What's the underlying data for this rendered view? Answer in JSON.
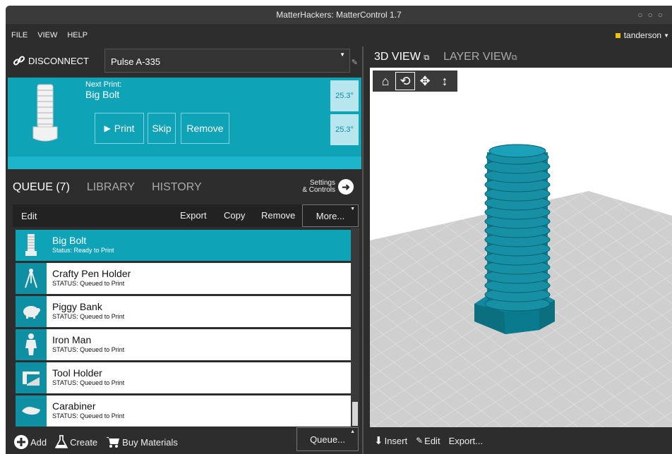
{
  "window": {
    "title": "MatterHackers: MatterControl 1.7"
  },
  "menu": {
    "items": [
      "FILE",
      "VIEW",
      "HELP"
    ],
    "user": "tanderson"
  },
  "connection": {
    "disconnect_label": "DISCONNECT",
    "printer": "Pulse A-335"
  },
  "next_print": {
    "label": "Next Print:",
    "name": "Big Bolt",
    "print_label": "Print",
    "skip_label": "Skip",
    "remove_label": "Remove",
    "temp1": "25.3°",
    "temp2": "25.3°"
  },
  "tabs": {
    "queue": "QUEUE (7)",
    "library": "LIBRARY",
    "history": "HISTORY",
    "settings_line1": "Settings",
    "settings_line2": "& Controls"
  },
  "toolbar": {
    "edit": "Edit",
    "export": "Export",
    "copy": "Copy",
    "remove": "Remove",
    "more": "More..."
  },
  "queue_items": [
    {
      "name": "Big Bolt",
      "status": "Status: Ready to Print",
      "icon": "bolt-icon"
    },
    {
      "name": "Crafty Pen Holder",
      "status": "STATUS: Queued to Print",
      "icon": "pen-holder-icon"
    },
    {
      "name": "Piggy Bank",
      "status": "STATUS: Queued to Print",
      "icon": "piggy-bank-icon"
    },
    {
      "name": "Iron Man",
      "status": "STATUS: Queued to Print",
      "icon": "figure-icon"
    },
    {
      "name": "Tool Holder",
      "status": "STATUS: Queued to Print",
      "icon": "tool-holder-icon"
    },
    {
      "name": "Carabiner",
      "status": "STATUS: Queued to Print",
      "icon": "carabiner-icon"
    }
  ],
  "bottom": {
    "add": "Add",
    "create": "Create",
    "buy": "Buy Materials",
    "queue": "Queue..."
  },
  "view": {
    "tab_3d": "3D VIEW",
    "tab_layer": "LAYER VIEW",
    "insert": "Insert",
    "edit": "Edit",
    "export": "Export..."
  },
  "colors": {
    "accent": "#0fa3b8",
    "model": "#0e7f92",
    "bed": "#cfcfcf"
  }
}
